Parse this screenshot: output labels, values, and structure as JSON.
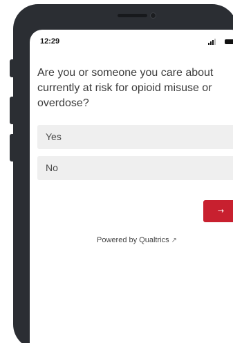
{
  "status_bar": {
    "time": "12:29",
    "icons": [
      "signal-icon",
      "battery-icon"
    ]
  },
  "survey": {
    "question": "Are you or someone you care about currently at risk for opioid misuse or overdose?",
    "choices": [
      {
        "label": "Yes"
      },
      {
        "label": "No"
      }
    ],
    "next_button": {
      "label": "→",
      "color": "#c8202f"
    }
  },
  "footer": {
    "powered_by": "Powered by Qualtrics",
    "link_icon": "↗"
  },
  "colors": {
    "phone_frame": "#2b2e33",
    "choice_background": "#efefef",
    "text": "#3b3b3b"
  }
}
